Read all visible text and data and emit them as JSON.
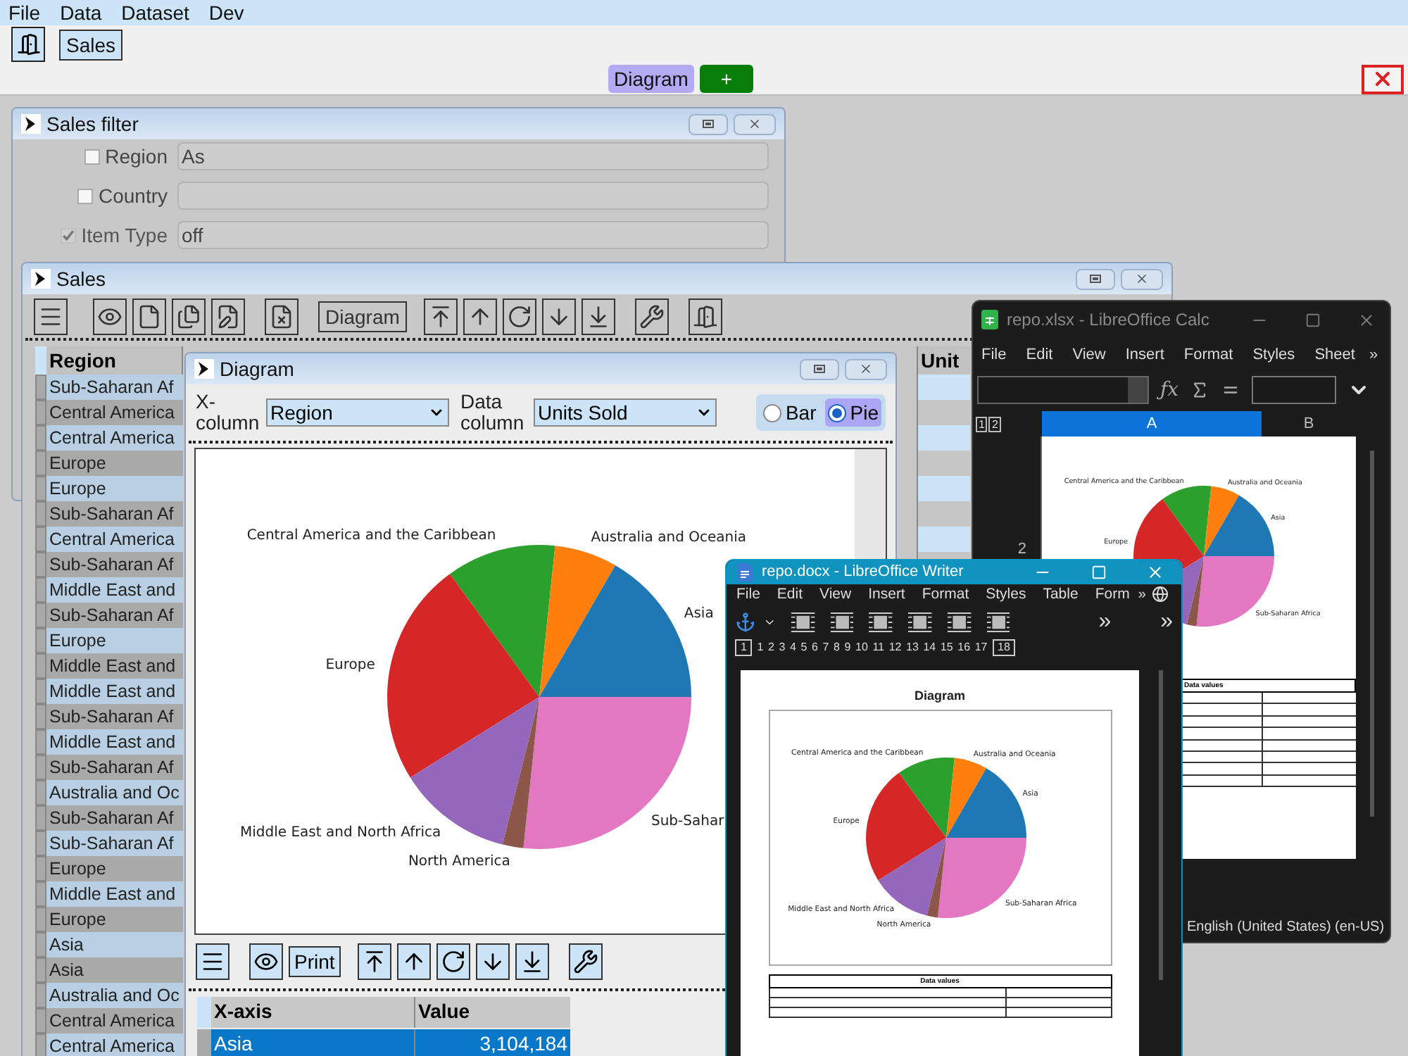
{
  "menu_bar": [
    "File",
    "Data",
    "Dataset",
    "Dev"
  ],
  "toolbar": {
    "sales_tab": "Sales"
  },
  "tab_strip": {
    "tabs": [
      {
        "label": "Diagram",
        "selected": true
      }
    ],
    "add_label": "+"
  },
  "sales_filter": {
    "title": "Sales filter",
    "fields": [
      {
        "label": "Region",
        "checked": false,
        "disabled": false,
        "value": "As"
      },
      {
        "label": "Country",
        "checked": false,
        "disabled": false
      },
      {
        "label": "Item Type",
        "checked": true,
        "disabled": true,
        "value": "off"
      }
    ]
  },
  "sales": {
    "title": "Sales",
    "diagram_button": "Diagram",
    "columns": [
      "Region",
      "Unit"
    ],
    "rows": [
      "Sub-Saharan Af",
      "Central America",
      "Central America",
      "Europe",
      "Europe",
      "Sub-Saharan Af",
      "Central America",
      "Sub-Saharan Af",
      "Middle East and",
      "Sub-Saharan Af",
      "Europe",
      "Middle East and",
      "Middle East and",
      "Sub-Saharan Af",
      "Middle East and",
      "Sub-Saharan Af",
      "Australia and Oc",
      "Sub-Saharan Af",
      "Sub-Saharan Af",
      "Europe",
      "Middle East and",
      "Europe",
      "Asia",
      "Asia",
      "Australia and Oc",
      "Central America",
      "Central America"
    ]
  },
  "diagram": {
    "title": "Diagram",
    "x_column": {
      "label": "X-column",
      "value": "Region"
    },
    "data_column": {
      "label": "Data column",
      "value": "Units Sold"
    },
    "chart_types": [
      {
        "label": "Bar",
        "selected": false
      },
      {
        "label": "Pie",
        "selected": true
      }
    ],
    "slices": [
      {
        "label": "Central America and the Caribbean",
        "color": "#2ca02c"
      },
      {
        "label": "Australia and Oceania",
        "color": "#ff7f0e"
      },
      {
        "label": "Asia",
        "color": "#1f77b4"
      },
      {
        "label": "Europe",
        "color": "#d62728"
      },
      {
        "label": "Sub-Sahar",
        "color": "#e377c2"
      },
      {
        "label": "Middle East and North Africa",
        "color": "#9467bd"
      },
      {
        "label": "North America",
        "color": "#8c564b"
      }
    ],
    "print_button": "Print",
    "table": {
      "columns": [
        "X-axis",
        "Value"
      ],
      "rows": [
        {
          "x": "Asia",
          "value": "3,104,184",
          "selected": true
        }
      ]
    }
  },
  "calc": {
    "title": "repo.xlsx - LibreOffice Calc",
    "menu": [
      "File",
      "Edit",
      "View",
      "Insert",
      "Format",
      "Styles",
      "Sheet"
    ],
    "more": "»",
    "fx_label": "ƒx",
    "outline_levels": [
      "1",
      "2"
    ],
    "columns": [
      {
        "label": "A",
        "selected": true
      },
      {
        "label": "B",
        "selected": false
      }
    ],
    "row_number": "2",
    "slices": [
      {
        "label": "Central America and the Caribbean",
        "color": "#2ca02c"
      },
      {
        "label": "Australia and Oceania",
        "color": "#ff7f0e"
      },
      {
        "label": "Asia",
        "color": "#1f77b4"
      },
      {
        "label": "Europe",
        "color": "#d62728"
      },
      {
        "label": "Sub-Saharan Africa",
        "color": "#e377c2"
      },
      {
        "color": "#9467bd"
      },
      {
        "color": "#8c564b"
      }
    ],
    "table_title": "Data values",
    "status": "English (United States) (en-US)"
  },
  "writer": {
    "title": "repo.docx - LibreOffice Writer",
    "menu": [
      "File",
      "Edit",
      "View",
      "Insert",
      "Format",
      "Styles",
      "Table",
      "Form"
    ],
    "more": "»",
    "toolbar_more": [
      "»",
      "»"
    ],
    "ruler": [
      "1",
      "1",
      "2",
      "3",
      "4",
      "5",
      "6",
      "7",
      "8",
      "9",
      "10",
      "11",
      "12",
      "13",
      "14",
      "15",
      "16",
      "17",
      "18"
    ],
    "doc_title": "Diagram",
    "slices": [
      {
        "label": "Central America and the Caribbean",
        "color": "#2ca02c"
      },
      {
        "label": "Australia and Oceania",
        "color": "#ff7f0e"
      },
      {
        "label": "Asia",
        "color": "#1f77b4"
      },
      {
        "label": "Europe",
        "color": "#d62728"
      },
      {
        "label": "Sub-Saharan Africa",
        "color": "#e377c2"
      },
      {
        "label": "Middle East and North Africa",
        "color": "#9467bd"
      },
      {
        "label": "North America",
        "color": "#8c564b"
      }
    ],
    "table_title": "Data values"
  }
}
